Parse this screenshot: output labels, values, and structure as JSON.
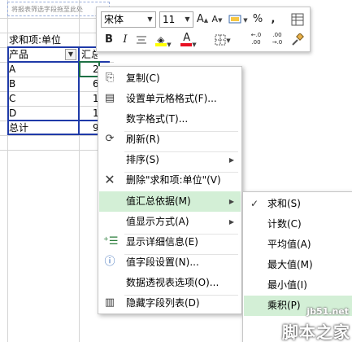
{
  "pivot": {
    "drop_hint": "将报表筛选字段拖至此处",
    "value_field_label": "求和项:单位",
    "row_header": "产品",
    "value_header_partial": "汇总",
    "rows": [
      {
        "label": "A",
        "value": "2"
      },
      {
        "label": "B",
        "value": "6"
      },
      {
        "label": "C",
        "value": "1"
      },
      {
        "label": "D",
        "value": "1"
      }
    ],
    "total_label": "总计",
    "total_value": "9"
  },
  "mini_toolbar": {
    "font_name": "宋体",
    "font_size": "11",
    "grow_font": "A",
    "shrink_font": "A",
    "percent": "%",
    "comma": ",",
    "bold": "B",
    "italic": "I",
    "font_color_glyph": "A",
    "increase_decimal": "←.0\n.00",
    "decrease_decimal": ".00\n→.0",
    "colors": {
      "fill": "#ffff00",
      "font": "#e81123"
    }
  },
  "context_menu": {
    "items": [
      {
        "label": "复制(C)",
        "icon": "copy-icon",
        "submenu": false
      },
      {
        "label": "设置单元格格式(F)...",
        "icon": "format-cells-icon",
        "submenu": false
      },
      {
        "label": "数字格式(T)...",
        "icon": "",
        "submenu": false
      },
      {
        "label": "刷新(R)",
        "icon": "refresh-icon",
        "submenu": false
      },
      {
        "label": "排序(S)",
        "icon": "",
        "submenu": true
      },
      {
        "label": "删除\"求和项:单位\"(V)",
        "icon": "delete-icon",
        "submenu": false
      },
      {
        "label": "值汇总依据(M)",
        "icon": "",
        "submenu": true,
        "highlighted": true
      },
      {
        "label": "值显示方式(A)",
        "icon": "",
        "submenu": true
      },
      {
        "label": "显示详细信息(E)",
        "icon": "show-details-icon",
        "submenu": false
      },
      {
        "label": "值字段设置(N)...",
        "icon": "field-settings-icon",
        "submenu": false
      },
      {
        "label": "数据透视表选项(O)...",
        "icon": "",
        "submenu": false
      },
      {
        "label": "隐藏字段列表(D)",
        "icon": "field-list-icon",
        "submenu": false
      }
    ]
  },
  "summarize_submenu": {
    "items": [
      {
        "label": "求和(S)",
        "checked": true
      },
      {
        "label": "计数(C)",
        "checked": false
      },
      {
        "label": "平均值(A)",
        "checked": false
      },
      {
        "label": "最大值(M)",
        "checked": false
      },
      {
        "label": "最小值(I)",
        "checked": false
      },
      {
        "label": "乘积(P)",
        "checked": false,
        "highlighted": true
      }
    ]
  },
  "watermark": {
    "site": "jb51.net",
    "name": "脚本之家"
  },
  "accent_colors": {
    "highlight": "#d3efd6",
    "pivot_border": "#1f3aa8",
    "selection": "#1e7145"
  }
}
